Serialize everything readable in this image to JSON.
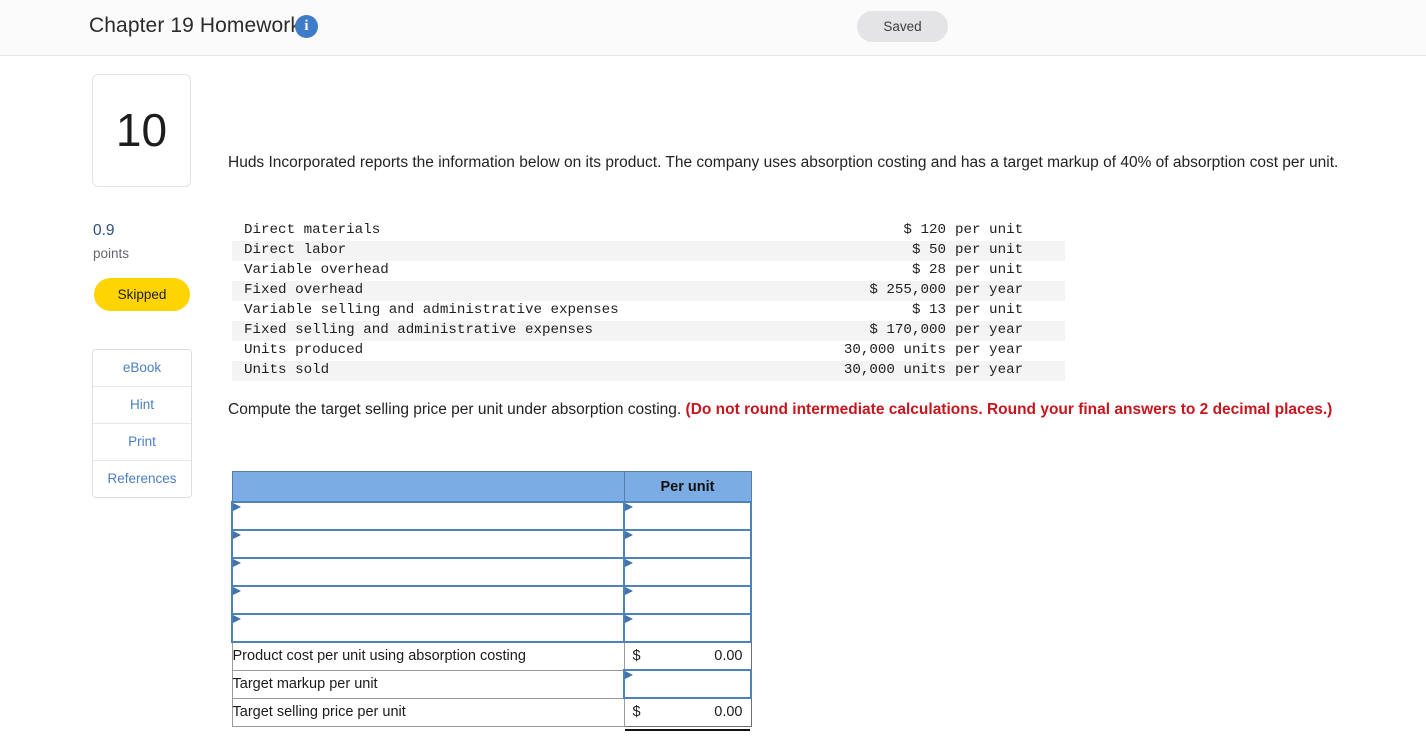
{
  "topbar": {
    "title": "Chapter 19 Homework",
    "info_icon": "info-icon",
    "status": "Saved"
  },
  "sidebar": {
    "question_number": "10",
    "points_value": "0.9",
    "points_label": "points",
    "status_badge": "Skipped",
    "tools": [
      {
        "label": "eBook",
        "name": "ebook"
      },
      {
        "label": "Hint",
        "name": "hint"
      },
      {
        "label": "Print",
        "name": "print"
      },
      {
        "label": "References",
        "name": "references"
      }
    ]
  },
  "main": {
    "prompt": "Huds Incorporated reports the information below on its product. The company uses absorption costing and has a target markup of 40% of absorption cost per unit.",
    "question_text": "Compute the target selling price per unit under absorption costing.",
    "question_emphasis": "(Do not round intermediate calculations. Round your final answers to 2 decimal places.)",
    "facts": [
      {
        "label": "Direct materials",
        "amount": "$ 120",
        "suffix": "per unit"
      },
      {
        "label": "Direct labor",
        "amount": "$ 50",
        "suffix": "per unit"
      },
      {
        "label": "Variable overhead",
        "amount": "$ 28",
        "suffix": "per unit"
      },
      {
        "label": "Fixed overhead",
        "amount": "$ 255,000",
        "suffix": "per year"
      },
      {
        "label": "Variable selling and administrative expenses",
        "amount": "$ 13",
        "suffix": "per unit"
      },
      {
        "label": "Fixed selling and administrative expenses",
        "amount": "$ 170,000",
        "suffix": "per year"
      },
      {
        "label": "Units produced",
        "amount": "30,000 units",
        "suffix": "per year"
      },
      {
        "label": "Units sold",
        "amount": "30,000 units",
        "suffix": "per year"
      }
    ],
    "answer_table": {
      "header_blank": "",
      "header_per_unit": "Per unit",
      "rows": [
        {
          "type": "entry",
          "label": "",
          "value": "",
          "name": "answer-row-1"
        },
        {
          "type": "entry",
          "label": "",
          "value": "",
          "name": "answer-row-2"
        },
        {
          "type": "entry",
          "label": "",
          "value": "",
          "name": "answer-row-3"
        },
        {
          "type": "entry",
          "label": "",
          "value": "",
          "name": "answer-row-4"
        },
        {
          "type": "entry",
          "label": "",
          "value": "",
          "name": "answer-row-5"
        },
        {
          "type": "total",
          "label": "Product cost per unit using absorption costing",
          "currency": "$",
          "value": "0.00",
          "name": "product-cost-row"
        },
        {
          "type": "input",
          "label": "Target markup per unit",
          "value": "",
          "name": "target-markup-row"
        },
        {
          "type": "total",
          "label": "Target selling price per unit",
          "currency": "$",
          "value": "0.00",
          "name": "target-selling-price-row"
        }
      ]
    }
  },
  "colors": {
    "table_header_blue": "#7bade4",
    "input_border_blue": "#4f82b8",
    "badge_yellow": "#ffd400",
    "emphasis_red": "#c7161d",
    "link_blue": "#4a7fc0",
    "info_blue": "#3d7cc9"
  }
}
